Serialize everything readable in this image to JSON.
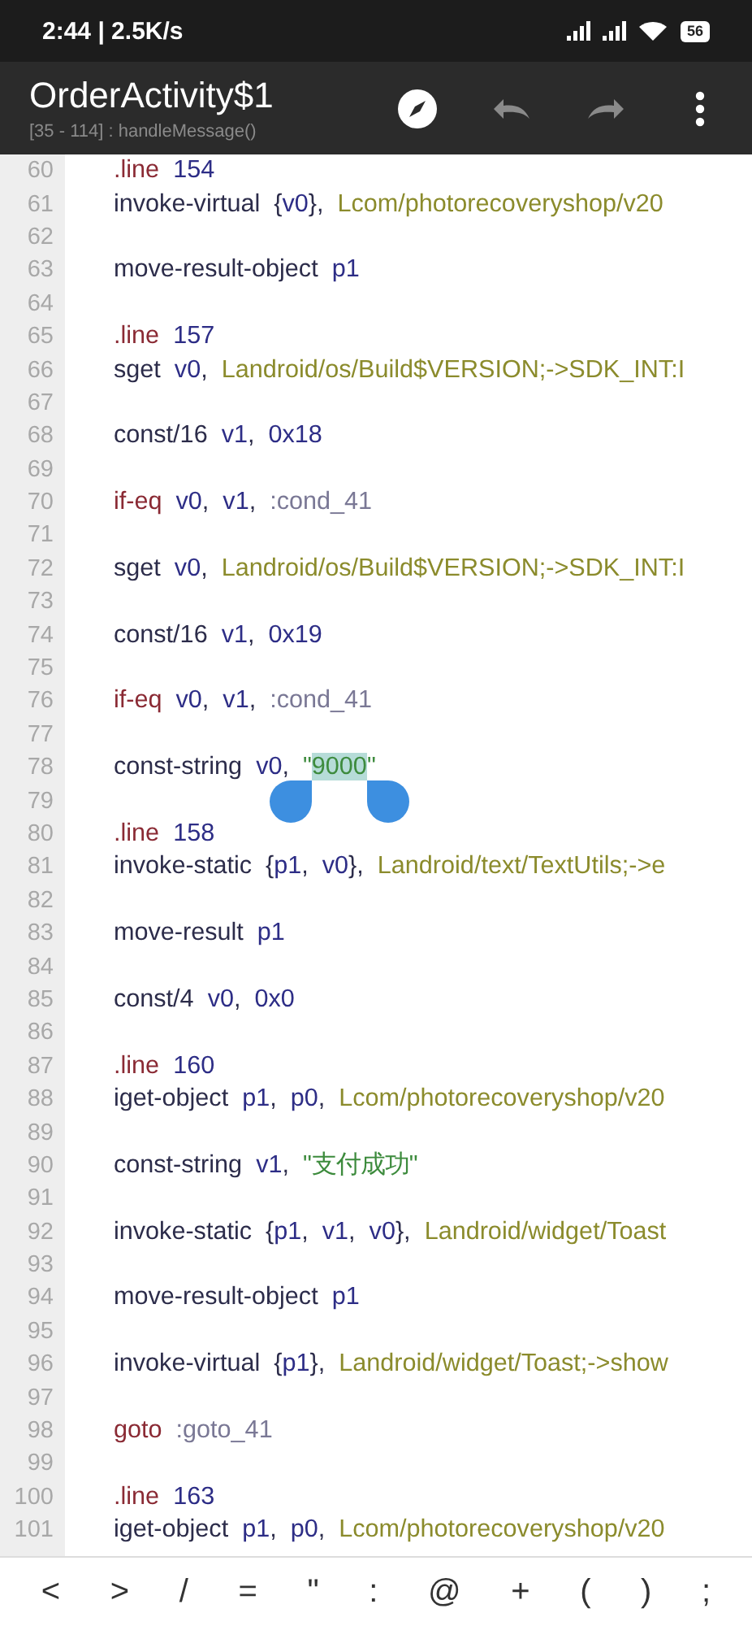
{
  "status_bar": {
    "time": "2:44 | 2.5K/s",
    "battery": "56"
  },
  "toolbar": {
    "title": "OrderActivity$1",
    "subtitle": "[35 - 114] : handleMessage()",
    "actions": [
      {
        "kind": "compass",
        "disabled": false
      },
      {
        "kind": "undo",
        "disabled": true
      },
      {
        "kind": "redo",
        "disabled": true
      },
      {
        "kind": "more",
        "disabled": false
      }
    ]
  },
  "editor": {
    "lines": [
      {
        "number": "60",
        "tokens": [
          {
            "text": ".line  ",
            "kind": "keyword",
            "selected": false
          },
          {
            "text": "154",
            "kind": "num",
            "selected": false
          }
        ]
      },
      {
        "number": "61",
        "tokens": [
          {
            "text": "invoke-virtual  ",
            "kind": "op",
            "selected": false
          },
          {
            "text": "{",
            "kind": "punct",
            "selected": false
          },
          {
            "text": "v0",
            "kind": "reg",
            "selected": false
          },
          {
            "text": "},  ",
            "kind": "punct",
            "selected": false
          },
          {
            "text": "Lcom/photorecoveryshop/v20",
            "kind": "type",
            "selected": false
          }
        ]
      },
      {
        "number": "62"
      },
      {
        "number": "63",
        "tokens": [
          {
            "text": "move-result-object  ",
            "kind": "op",
            "selected": false
          },
          {
            "text": "p1",
            "kind": "reg",
            "selected": false
          }
        ]
      },
      {
        "number": "64"
      },
      {
        "number": "65",
        "tokens": [
          {
            "text": ".line  ",
            "kind": "keyword",
            "selected": false
          },
          {
            "text": "157",
            "kind": "num",
            "selected": false
          }
        ]
      },
      {
        "number": "66",
        "tokens": [
          {
            "text": "sget  ",
            "kind": "op",
            "selected": false
          },
          {
            "text": "v0",
            "kind": "reg",
            "selected": false
          },
          {
            "text": ",  ",
            "kind": "punct",
            "selected": false
          },
          {
            "text": "Landroid/os/Build$VERSION;->SDK_INT:I",
            "kind": "type",
            "selected": false
          }
        ]
      },
      {
        "number": "67"
      },
      {
        "number": "68",
        "tokens": [
          {
            "text": "const/16  ",
            "kind": "op",
            "selected": false
          },
          {
            "text": "v1",
            "kind": "reg",
            "selected": false
          },
          {
            "text": ",  ",
            "kind": "punct",
            "selected": false
          },
          {
            "text": "0x18",
            "kind": "num",
            "selected": false
          }
        ]
      },
      {
        "number": "69"
      },
      {
        "number": "70",
        "tokens": [
          {
            "text": "if-eq  ",
            "kind": "keyword",
            "selected": false
          },
          {
            "text": "v0",
            "kind": "reg",
            "selected": false
          },
          {
            "text": ",  ",
            "kind": "punct",
            "selected": false
          },
          {
            "text": "v1",
            "kind": "reg",
            "selected": false
          },
          {
            "text": ",  ",
            "kind": "punct",
            "selected": false
          },
          {
            "text": ":cond_41",
            "kind": "label",
            "selected": false
          }
        ]
      },
      {
        "number": "71"
      },
      {
        "number": "72",
        "tokens": [
          {
            "text": "sget  ",
            "kind": "op",
            "selected": false
          },
          {
            "text": "v0",
            "kind": "reg",
            "selected": false
          },
          {
            "text": ",  ",
            "kind": "punct",
            "selected": false
          },
          {
            "text": "Landroid/os/Build$VERSION;->SDK_INT:I",
            "kind": "type",
            "selected": false
          }
        ]
      },
      {
        "number": "73"
      },
      {
        "number": "74",
        "tokens": [
          {
            "text": "const/16  ",
            "kind": "op",
            "selected": false
          },
          {
            "text": "v1",
            "kind": "reg",
            "selected": false
          },
          {
            "text": ",  ",
            "kind": "punct",
            "selected": false
          },
          {
            "text": "0x19",
            "kind": "num",
            "selected": false
          }
        ]
      },
      {
        "number": "75"
      },
      {
        "number": "76",
        "tokens": [
          {
            "text": "if-eq  ",
            "kind": "keyword",
            "selected": false
          },
          {
            "text": "v0",
            "kind": "reg",
            "selected": false
          },
          {
            "text": ",  ",
            "kind": "punct",
            "selected": false
          },
          {
            "text": "v1",
            "kind": "reg",
            "selected": false
          },
          {
            "text": ",  ",
            "kind": "punct",
            "selected": false
          },
          {
            "text": ":cond_41",
            "kind": "label",
            "selected": false
          }
        ]
      },
      {
        "number": "77"
      },
      {
        "number": "78",
        "tokens": [
          {
            "text": "const-string  ",
            "kind": "op",
            "selected": false
          },
          {
            "text": "v0",
            "kind": "reg",
            "selected": false
          },
          {
            "text": ",  ",
            "kind": "punct",
            "selected": false
          },
          {
            "text": "\"",
            "kind": "str",
            "selected": false
          },
          {
            "text": "9000",
            "kind": "str",
            "selected": true
          },
          {
            "text": "\"",
            "kind": "str",
            "selected": false
          }
        ]
      },
      {
        "number": "79"
      },
      {
        "number": "80",
        "tokens": [
          {
            "text": ".line  ",
            "kind": "keyword",
            "selected": false
          },
          {
            "text": "158",
            "kind": "num",
            "selected": false
          }
        ]
      },
      {
        "number": "81",
        "tokens": [
          {
            "text": "invoke-static  ",
            "kind": "op",
            "selected": false
          },
          {
            "text": "{",
            "kind": "punct",
            "selected": false
          },
          {
            "text": "p1",
            "kind": "reg",
            "selected": false
          },
          {
            "text": ",  ",
            "kind": "punct",
            "selected": false
          },
          {
            "text": "v0",
            "kind": "reg",
            "selected": false
          },
          {
            "text": "},  ",
            "kind": "punct",
            "selected": false
          },
          {
            "text": "Landroid/text/TextUtils;->e",
            "kind": "type",
            "selected": false
          }
        ]
      },
      {
        "number": "82"
      },
      {
        "number": "83",
        "tokens": [
          {
            "text": "move-result  ",
            "kind": "op",
            "selected": false
          },
          {
            "text": "p1",
            "kind": "reg",
            "selected": false
          }
        ]
      },
      {
        "number": "84"
      },
      {
        "number": "85",
        "tokens": [
          {
            "text": "const/4  ",
            "kind": "op",
            "selected": false
          },
          {
            "text": "v0",
            "kind": "reg",
            "selected": false
          },
          {
            "text": ",  ",
            "kind": "punct",
            "selected": false
          },
          {
            "text": "0x0",
            "kind": "num",
            "selected": false
          }
        ]
      },
      {
        "number": "86"
      },
      {
        "number": "87",
        "tokens": [
          {
            "text": ".line  ",
            "kind": "keyword",
            "selected": false
          },
          {
            "text": "160",
            "kind": "num",
            "selected": false
          }
        ]
      },
      {
        "number": "88",
        "tokens": [
          {
            "text": "iget-object  ",
            "kind": "op",
            "selected": false
          },
          {
            "text": "p1",
            "kind": "reg",
            "selected": false
          },
          {
            "text": ",  ",
            "kind": "punct",
            "selected": false
          },
          {
            "text": "p0",
            "kind": "reg",
            "selected": false
          },
          {
            "text": ",  ",
            "kind": "punct",
            "selected": false
          },
          {
            "text": "Lcom/photorecoveryshop/v20",
            "kind": "type",
            "selected": false
          }
        ]
      },
      {
        "number": "89"
      },
      {
        "number": "90",
        "tokens": [
          {
            "text": "const-string  ",
            "kind": "op",
            "selected": false
          },
          {
            "text": "v1",
            "kind": "reg",
            "selected": false
          },
          {
            "text": ",  ",
            "kind": "punct",
            "selected": false
          },
          {
            "text": "\"支付成功\"",
            "kind": "str",
            "selected": false
          }
        ]
      },
      {
        "number": "91"
      },
      {
        "number": "92",
        "tokens": [
          {
            "text": "invoke-static  ",
            "kind": "op",
            "selected": false
          },
          {
            "text": "{",
            "kind": "punct",
            "selected": false
          },
          {
            "text": "p1",
            "kind": "reg",
            "selected": false
          },
          {
            "text": ",  ",
            "kind": "punct",
            "selected": false
          },
          {
            "text": "v1",
            "kind": "reg",
            "selected": false
          },
          {
            "text": ",  ",
            "kind": "punct",
            "selected": false
          },
          {
            "text": "v0",
            "kind": "reg",
            "selected": false
          },
          {
            "text": "},  ",
            "kind": "punct",
            "selected": false
          },
          {
            "text": "Landroid/widget/Toast",
            "kind": "type",
            "selected": false
          }
        ]
      },
      {
        "number": "93"
      },
      {
        "number": "94",
        "tokens": [
          {
            "text": "move-result-object  ",
            "kind": "op",
            "selected": false
          },
          {
            "text": "p1",
            "kind": "reg",
            "selected": false
          }
        ]
      },
      {
        "number": "95"
      },
      {
        "number": "96",
        "tokens": [
          {
            "text": "invoke-virtual  ",
            "kind": "op",
            "selected": false
          },
          {
            "text": "{",
            "kind": "punct",
            "selected": false
          },
          {
            "text": "p1",
            "kind": "reg",
            "selected": false
          },
          {
            "text": "},  ",
            "kind": "punct",
            "selected": false
          },
          {
            "text": "Landroid/widget/Toast;->show",
            "kind": "type",
            "selected": false
          }
        ]
      },
      {
        "number": "97"
      },
      {
        "number": "98",
        "tokens": [
          {
            "text": "goto  ",
            "kind": "keyword",
            "selected": false
          },
          {
            "text": ":goto_41",
            "kind": "label",
            "selected": false
          }
        ]
      },
      {
        "number": "99"
      },
      {
        "number": "100",
        "tokens": [
          {
            "text": ".line  ",
            "kind": "keyword",
            "selected": false
          },
          {
            "text": "163",
            "kind": "num",
            "selected": false
          }
        ]
      },
      {
        "number": "101",
        "tokens": [
          {
            "text": "iget-object  ",
            "kind": "op",
            "selected": false
          },
          {
            "text": "p1",
            "kind": "reg",
            "selected": false
          },
          {
            "text": ",  ",
            "kind": "punct",
            "selected": false
          },
          {
            "text": "p0",
            "kind": "reg",
            "selected": false
          },
          {
            "text": ",  ",
            "kind": "punct",
            "selected": false
          },
          {
            "text": "Lcom/photorecoveryshop/v20",
            "kind": "type",
            "selected": false
          }
        ]
      }
    ]
  },
  "symbol_keys": [
    "<",
    ">",
    "/",
    "=",
    "\"",
    ":",
    "@",
    "+",
    "(",
    ")",
    ";"
  ]
}
